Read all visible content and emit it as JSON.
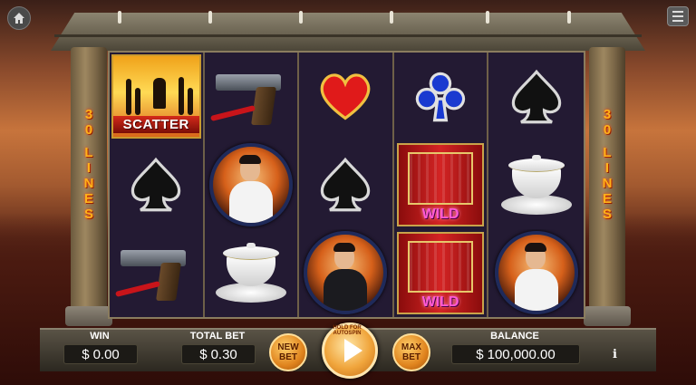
{
  "paylines_label": [
    "3",
    "0",
    "",
    "L",
    "I",
    "N",
    "E",
    "S"
  ],
  "reels": [
    [
      {
        "symbol": "scatter",
        "label": "SCATTER"
      },
      {
        "symbol": "spade",
        "label": ""
      },
      {
        "symbol": "pistol",
        "label": ""
      }
    ],
    [
      {
        "symbol": "pistol",
        "label": ""
      },
      {
        "symbol": "hero-white",
        "label": ""
      },
      {
        "symbol": "teacup",
        "label": ""
      }
    ],
    [
      {
        "symbol": "heart",
        "label": ""
      },
      {
        "symbol": "spade",
        "label": ""
      },
      {
        "symbol": "hero-dark",
        "label": ""
      }
    ],
    [
      {
        "symbol": "club",
        "label": ""
      },
      {
        "symbol": "wild",
        "label": "WILD"
      },
      {
        "symbol": "wild",
        "label": "WILD"
      }
    ],
    [
      {
        "symbol": "spade",
        "label": ""
      },
      {
        "symbol": "teacup",
        "label": ""
      },
      {
        "symbol": "hero-white",
        "label": ""
      }
    ]
  ],
  "bottom": {
    "win_label": "WIN",
    "win_currency": "$",
    "win_value": "0.00",
    "total_bet_label": "TOTAL BET",
    "total_bet_currency": "$",
    "total_bet_value": "0.30",
    "new_bet_label": "NEW\nBET",
    "max_bet_label": "MAX\nBET",
    "spin_hint": "HOLD FOR AUTOSPIN",
    "balance_label": "BALANCE",
    "balance_currency": "$",
    "balance_value": "100,000.00",
    "info_label": "i"
  },
  "colors": {
    "lines_text": "#ffb21a",
    "heart": "#e01a1a",
    "club": "#1a3ad0",
    "spade": "#111111",
    "wild_text": "#ff59d6"
  }
}
